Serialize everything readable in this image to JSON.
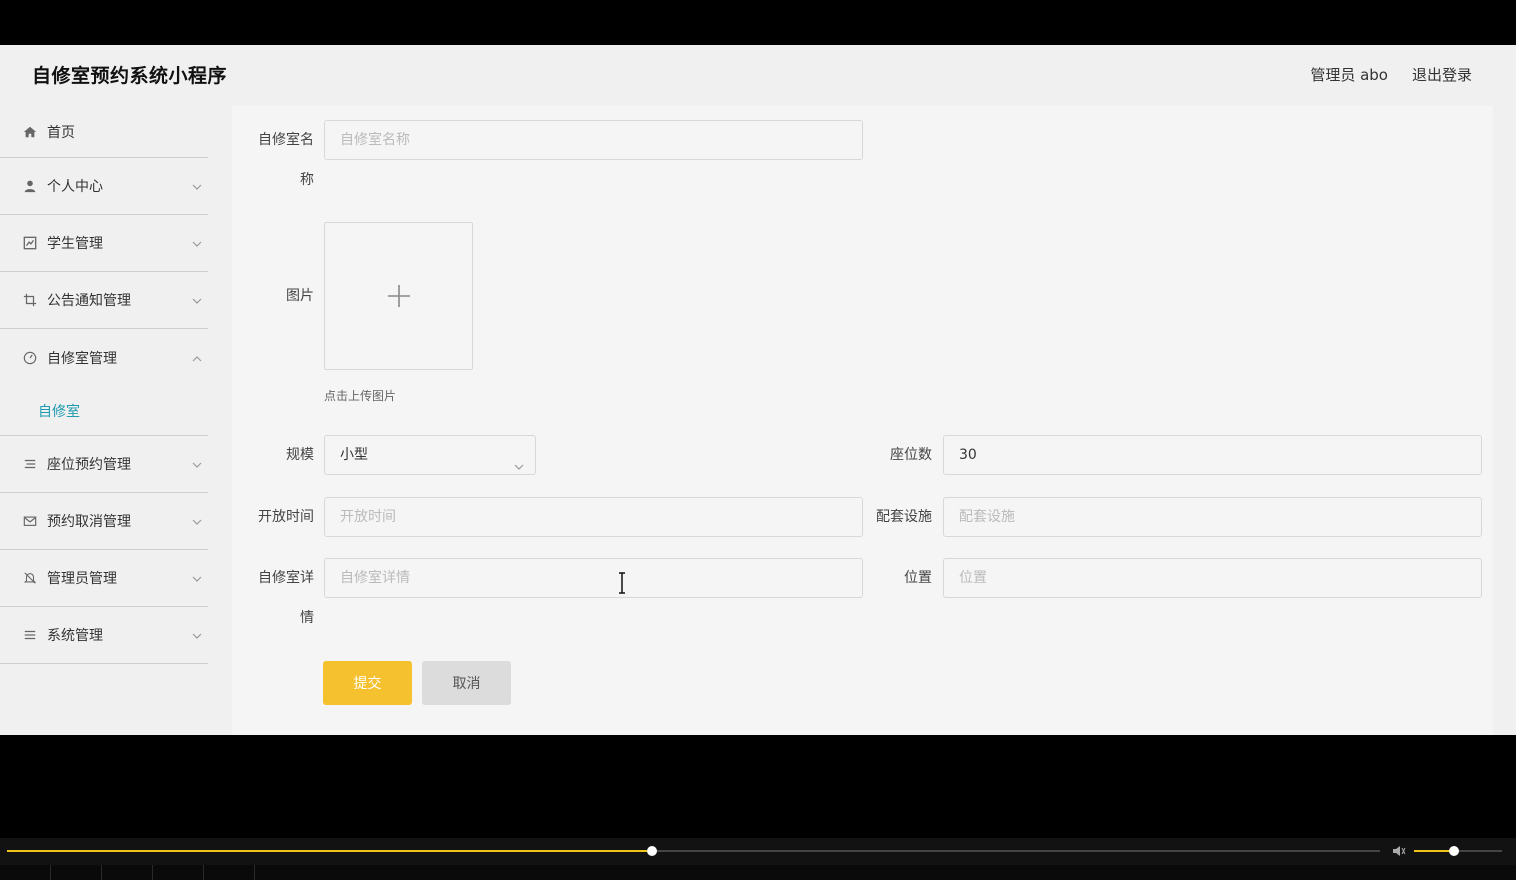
{
  "header": {
    "title": "自修室预约系统小程序",
    "user_label": "管理员 abo",
    "logout_label": "退出登录"
  },
  "sidebar": {
    "items": [
      {
        "label": "首页",
        "icon": "home-icon"
      },
      {
        "label": "个人中心",
        "icon": "user-icon"
      },
      {
        "label": "学生管理",
        "icon": "chart-icon"
      },
      {
        "label": "公告通知管理",
        "icon": "crop-icon"
      },
      {
        "label": "自修室管理",
        "icon": "gauge-icon",
        "expanded": true,
        "children": [
          {
            "label": "自修室",
            "active": true
          }
        ]
      },
      {
        "label": "座位预约管理",
        "icon": "list-icon"
      },
      {
        "label": "预约取消管理",
        "icon": "mail-icon"
      },
      {
        "label": "管理员管理",
        "icon": "bell-off-icon"
      },
      {
        "label": "系统管理",
        "icon": "menu-icon"
      }
    ]
  },
  "form": {
    "name_label_line1": "自修室名",
    "name_label_line2": "称",
    "name_placeholder": "自修室名称",
    "image_label": "图片",
    "upload_tip": "点击上传图片",
    "scale_label": "规模",
    "scale_value": "小型",
    "seats_label": "座位数",
    "seats_value": "30",
    "open_time_label": "开放时间",
    "open_time_placeholder": "开放时间",
    "facilities_label": "配套设施",
    "facilities_placeholder": "配套设施",
    "detail_label_line1": "自修室详",
    "detail_label_line2": "情",
    "detail_placeholder": "自修室详情",
    "location_label": "位置",
    "location_placeholder": "位置",
    "submit_label": "提交",
    "cancel_label": "取消"
  },
  "player": {
    "progress_fraction": 0.47,
    "volume_fraction": 0.45,
    "accent_color": "#f0c419"
  }
}
